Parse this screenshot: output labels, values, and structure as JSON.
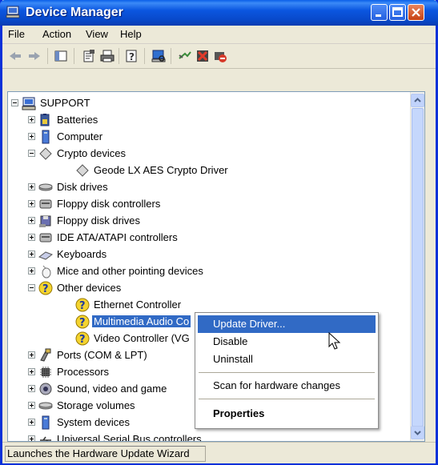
{
  "window": {
    "title": "Device Manager"
  },
  "menu": [
    "File",
    "Action",
    "View",
    "Help"
  ],
  "toolbar": {
    "icons": [
      "back-icon",
      "forward-icon",
      "console-tree-icon",
      "properties-icon",
      "print-icon",
      "help-icon",
      "scan-hardware-icon",
      "update-driver-icon",
      "uninstall-icon",
      "disable-icon"
    ]
  },
  "tree": {
    "root": "SUPPORT",
    "items": [
      {
        "label": "Batteries",
        "icon": "battery-icon",
        "expanded": false
      },
      {
        "label": "Computer",
        "icon": "computer-icon",
        "expanded": false
      },
      {
        "label": "Crypto devices",
        "icon": "crypto-icon",
        "expanded": true
      },
      {
        "label": "Geode LX AES Crypto Driver",
        "icon": "crypto-icon",
        "child": true
      },
      {
        "label": "Disk drives",
        "icon": "disk-icon",
        "expanded": false
      },
      {
        "label": "Floppy disk controllers",
        "icon": "controller-icon",
        "expanded": false
      },
      {
        "label": "Floppy disk drives",
        "icon": "floppy-icon",
        "expanded": false
      },
      {
        "label": "IDE ATA/ATAPI controllers",
        "icon": "controller-icon",
        "expanded": false
      },
      {
        "label": "Keyboards",
        "icon": "keyboard-icon",
        "expanded": false
      },
      {
        "label": "Mice and other pointing devices",
        "icon": "mouse-icon",
        "expanded": false
      },
      {
        "label": "Other devices",
        "icon": "unknown-device-icon",
        "expanded": true
      },
      {
        "label": "Ethernet Controller",
        "icon": "unknown-device-icon",
        "child": true
      },
      {
        "label": "Multimedia Audio Co",
        "icon": "unknown-device-icon",
        "child": true,
        "selected": true
      },
      {
        "label": "Video Controller (VG",
        "icon": "unknown-device-icon",
        "child": true
      },
      {
        "label": "Ports (COM & LPT)",
        "icon": "port-icon",
        "expanded": false
      },
      {
        "label": "Processors",
        "icon": "processor-icon",
        "expanded": false
      },
      {
        "label": "Sound, video and game",
        "icon": "sound-icon",
        "expanded": false
      },
      {
        "label": "Storage volumes",
        "icon": "disk-icon",
        "expanded": false
      },
      {
        "label": "System devices",
        "icon": "system-icon",
        "expanded": false
      },
      {
        "label": "Universal Serial Bus controllers",
        "icon": "usb-icon",
        "expanded": false
      }
    ]
  },
  "context_menu": {
    "update_driver": "Update Driver...",
    "disable": "Disable",
    "uninstall": "Uninstall",
    "scan": "Scan for hardware changes",
    "properties": "Properties"
  },
  "status": {
    "text": "Launches the Hardware Update Wizard"
  },
  "colors": {
    "title_bar": "#0a5fe8",
    "selection": "#316ac5",
    "window_bg": "#ece9d8"
  }
}
